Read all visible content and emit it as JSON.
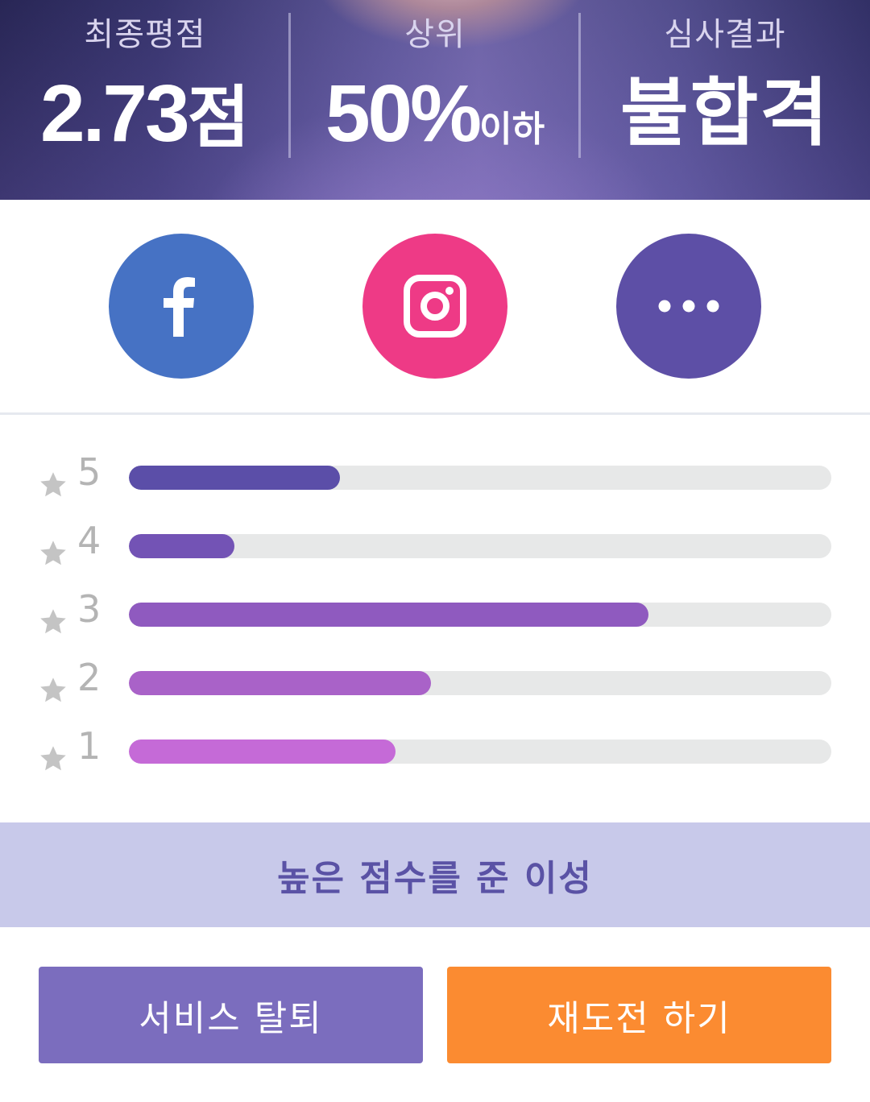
{
  "stats": {
    "final_score": {
      "label": "최종평점",
      "value": "2.73",
      "suffix": "점"
    },
    "rank": {
      "label": "상위",
      "value": "50%",
      "suffix": "이하"
    },
    "result": {
      "label": "심사결과",
      "value": "불합격"
    }
  },
  "share": [
    {
      "name": "facebook",
      "icon": "facebook-icon",
      "color": "#4672c4"
    },
    {
      "name": "instagram",
      "icon": "instagram-icon",
      "color": "#ee3a86"
    },
    {
      "name": "more",
      "icon": "more-dots-icon",
      "color": "#5d4fa6"
    }
  ],
  "ratings": [
    {
      "stars": "5",
      "fraction": 0.3,
      "color": "#5b4ea8"
    },
    {
      "stars": "4",
      "fraction": 0.15,
      "color": "#7353b5"
    },
    {
      "stars": "3",
      "fraction": 0.74,
      "color": "#8f5abf"
    },
    {
      "stars": "2",
      "fraction": 0.43,
      "color": "#a962c8"
    },
    {
      "stars": "1",
      "fraction": 0.38,
      "color": "#c56ad7"
    }
  ],
  "high_score": {
    "label": "높은 점수를 준 이성"
  },
  "buttons": {
    "leave": "서비스 탈퇴",
    "retry": "재도전 하기"
  },
  "colors": {
    "track": "#e7e8e8",
    "star": "#c4c4c4",
    "high_score_bg": "#c8c9ea",
    "leave_bg": "#7b6dbe",
    "retry_bg": "#fb8b31"
  }
}
